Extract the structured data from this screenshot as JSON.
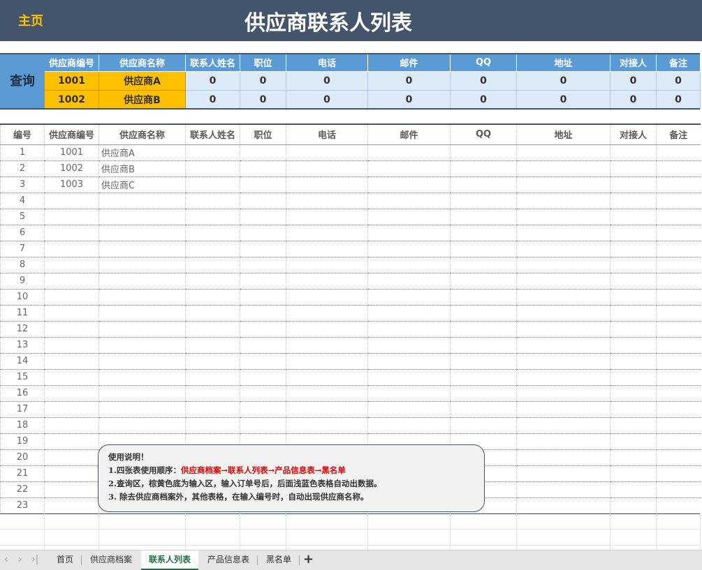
{
  "header": {
    "home_label": "主页",
    "title": "供应商联系人列表"
  },
  "query": {
    "label": "查询",
    "headers": [
      "供应商编号",
      "供应商名称",
      "联系人姓名",
      "职位",
      "电话",
      "邮件",
      "QQ",
      "地址",
      "对接人",
      "备注"
    ],
    "rows": [
      {
        "code": "1001",
        "name": "供应商A",
        "values": [
          "0",
          "0",
          "0",
          "0",
          "0",
          "0",
          "0",
          "0"
        ]
      },
      {
        "code": "1002",
        "name": "供应商B",
        "values": [
          "0",
          "0",
          "0",
          "0",
          "0",
          "0",
          "0",
          "0"
        ]
      }
    ]
  },
  "list": {
    "headers": [
      "编号",
      "供应商编号",
      "供应商名称",
      "联系人姓名",
      "职位",
      "电话",
      "邮件",
      "QQ",
      "地址",
      "对接人",
      "备注"
    ],
    "rows": [
      {
        "no": "1",
        "code": "1001",
        "name": "供应商A"
      },
      {
        "no": "2",
        "code": "1002",
        "name": "供应商B"
      },
      {
        "no": "3",
        "code": "1003",
        "name": "供应商C"
      },
      {
        "no": "4",
        "code": "",
        "name": ""
      },
      {
        "no": "5",
        "code": "",
        "name": ""
      },
      {
        "no": "6",
        "code": "",
        "name": ""
      },
      {
        "no": "7",
        "code": "",
        "name": ""
      },
      {
        "no": "8",
        "code": "",
        "name": ""
      },
      {
        "no": "9",
        "code": "",
        "name": ""
      },
      {
        "no": "10",
        "code": "",
        "name": ""
      },
      {
        "no": "11",
        "code": "",
        "name": ""
      },
      {
        "no": "12",
        "code": "",
        "name": ""
      },
      {
        "no": "13",
        "code": "",
        "name": ""
      },
      {
        "no": "14",
        "code": "",
        "name": ""
      },
      {
        "no": "15",
        "code": "",
        "name": ""
      },
      {
        "no": "16",
        "code": "",
        "name": ""
      },
      {
        "no": "17",
        "code": "",
        "name": ""
      },
      {
        "no": "18",
        "code": "",
        "name": ""
      },
      {
        "no": "19",
        "code": "",
        "name": ""
      },
      {
        "no": "20",
        "code": "",
        "name": ""
      },
      {
        "no": "21",
        "code": "",
        "name": ""
      },
      {
        "no": "22",
        "code": "",
        "name": ""
      },
      {
        "no": "23",
        "code": "",
        "name": ""
      }
    ]
  },
  "note": {
    "title": "使用说明！",
    "line1_prefix": "1.四张表使用顺序：",
    "line1_highlight": "供应商档案→联系人列表→产品信息表→黑名单",
    "line2": "2.查询区，棕黄色底为输入区，输入订单号后，后面浅蓝色表格自动出数据。",
    "line3": "3. 除去供应商档案外，其他表格，在输入编号时，自动出现供应商名称。"
  },
  "tabs": {
    "items": [
      "首页",
      "供应商档案",
      "联系人列表",
      "产品信息表",
      "黑名单"
    ],
    "active_index": 2,
    "add_label": "+"
  },
  "colors": {
    "banner": "#44546a",
    "home": "#ffc000",
    "header_blue": "#5b9bd5",
    "input": "#ffc000",
    "output": "#dce9f7",
    "active_tab": "#1e7145"
  }
}
